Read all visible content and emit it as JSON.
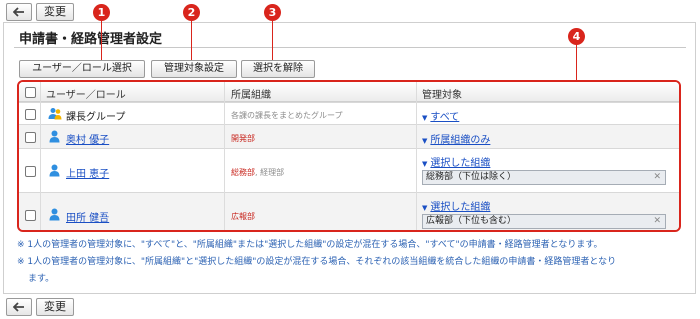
{
  "toolbar": {
    "change_label": "変更"
  },
  "page_title": "申請書・経路管理者設定",
  "actions": {
    "user_role_select": "ユーザー／ロール選択",
    "target_setting": "管理対象設定",
    "clear_selection": "選択を解除"
  },
  "table": {
    "headers": {
      "user_role": "ユーザー／ロール",
      "org": "所属組織",
      "target": "管理対象"
    },
    "rows": [
      {
        "type": "group",
        "name": "課長グループ",
        "org": "各課の課長をまとめたグループ",
        "target": "すべて"
      },
      {
        "type": "user",
        "name": "奥村 優子",
        "org": "開発部",
        "target": "所属組織のみ"
      },
      {
        "type": "user",
        "name": "上田 恵子",
        "org": "総務部",
        "org_extra": "経理部",
        "target": "選択した組織",
        "tag": "総務部（下位は除く）"
      },
      {
        "type": "user",
        "name": "田所 健吾",
        "org": "広報部",
        "target": "選択した組織",
        "tag": "広報部（下位も含む）"
      }
    ]
  },
  "notes": {
    "note1": "※ 1人の管理者の管理対象に、\"すべて\"と、\"所属組織\"または\"選択した組織\"の設定が混在する場合、\"すべて\"の申請書・経路管理者となります。",
    "note2_line1": "※ 1人の管理者の管理対象に、\"所属組織\"と\"選択した組織\"の設定が混在する場合、それぞれの該当組織を統合した組織の申請書・経路管理者となり",
    "note2_line2": "ます。"
  },
  "markers": [
    "1",
    "2",
    "3",
    "4"
  ],
  "colors": {
    "callout": "#d9251c",
    "link": "#1a4fc4",
    "note": "#2c62b3",
    "org_red": "#c8271f"
  },
  "icons": {
    "back": "back-arrow-icon",
    "group": "group-icon",
    "user": "user-icon",
    "dropdown": "dropdown-triangle-icon",
    "remove": "remove-x-icon"
  }
}
